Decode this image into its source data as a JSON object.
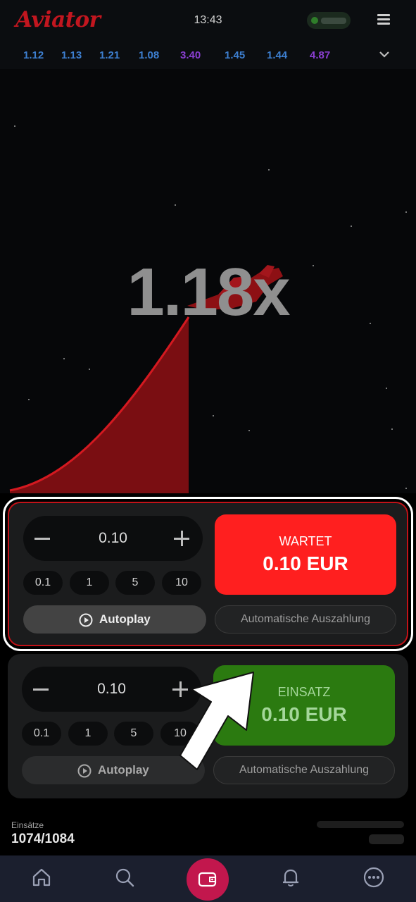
{
  "header": {
    "app_name": "Aviator",
    "time": "13:43"
  },
  "history": {
    "items": [
      {
        "value": "1.12",
        "color": "#3d7fd0"
      },
      {
        "value": "1.13",
        "color": "#3d7fd0"
      },
      {
        "value": "1.21",
        "color": "#3d7fd0"
      },
      {
        "value": "1.08",
        "color": "#3d7fd0"
      },
      {
        "value": "3.40",
        "color": "#8a3fd1"
      },
      {
        "value": "1.45",
        "color": "#3d7fd0"
      },
      {
        "value": "1.44",
        "color": "#3d7fd0"
      },
      {
        "value": "4.87",
        "color": "#8a3fd1"
      }
    ]
  },
  "game": {
    "multiplier": "1.18x",
    "curve_color": "#c4161c"
  },
  "bet_panels": [
    {
      "state": "waiting",
      "amount": "0.10",
      "quick_amounts": [
        "0.1",
        "1",
        "5",
        "10"
      ],
      "autoplay_label": "Autoplay",
      "auto_cashout_label": "Automatische Auszahlung",
      "button_title": "WARTET",
      "button_amount": "0.10 EUR",
      "button_color": "#ff1f1f"
    },
    {
      "state": "idle",
      "amount": "0.10",
      "quick_amounts": [
        "0.1",
        "1",
        "5",
        "10"
      ],
      "autoplay_label": "Autoplay",
      "auto_cashout_label": "Automatische Auszahlung",
      "button_title": "EINSATZ",
      "button_amount": "0.10 EUR",
      "button_color": "#2b7a10"
    }
  ],
  "stats": {
    "bets_label": "Einsätze",
    "bets_value": "1074/1084"
  },
  "nav": {
    "accent": "#c2174d",
    "tabs": [
      "home-icon",
      "search-icon",
      "wallet-icon",
      "bell-icon",
      "more-icon"
    ]
  }
}
